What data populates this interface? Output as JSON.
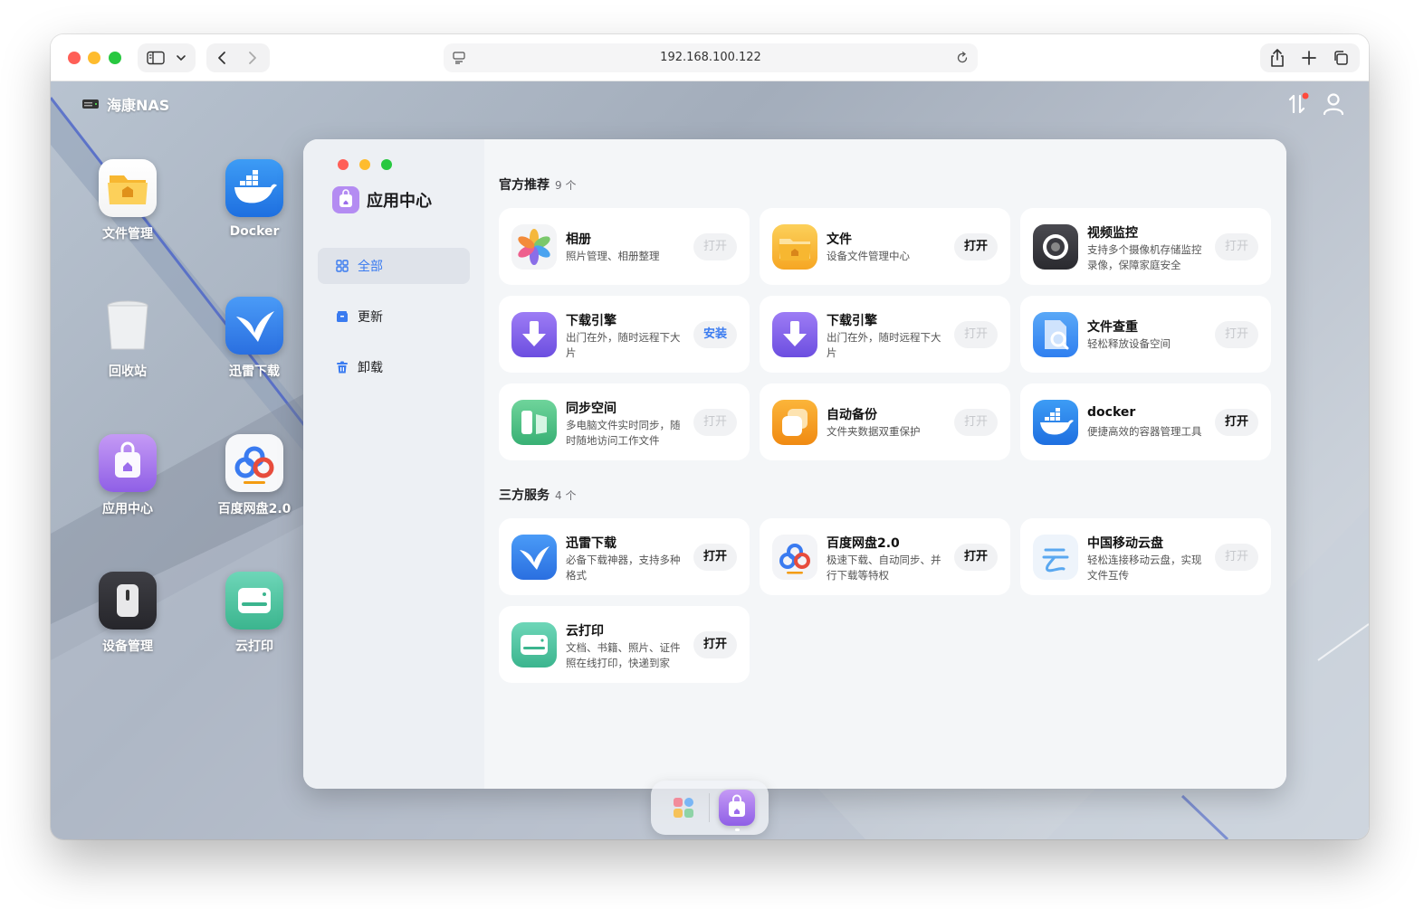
{
  "browser": {
    "url": "192.168.100.122"
  },
  "desktop": {
    "brand": "海康NAS",
    "icons": [
      {
        "label": "文件管理"
      },
      {
        "label": "Docker"
      },
      {
        "label": "回收站"
      },
      {
        "label": "迅雷下载"
      },
      {
        "label": "应用中心"
      },
      {
        "label": "百度网盘2.0"
      },
      {
        "label": "设备管理"
      },
      {
        "label": "云打印"
      }
    ]
  },
  "app": {
    "title": "应用中心",
    "nav": [
      {
        "label": "全部"
      },
      {
        "label": "更新"
      },
      {
        "label": "卸载"
      }
    ],
    "sections": [
      {
        "title": "官方推荐",
        "count": "9 个",
        "items": [
          {
            "name": "相册",
            "desc": "照片管理、相册整理",
            "action": "打开"
          },
          {
            "name": "文件",
            "desc": "设备文件管理中心",
            "action": "打开"
          },
          {
            "name": "视频监控",
            "desc": "支持多个摄像机存储监控录像，保障家庭安全",
            "action": "打开"
          },
          {
            "name": "下载引擎",
            "desc": "出门在外，随时远程下大片",
            "action": "安装"
          },
          {
            "name": "下载引擎",
            "desc": "出门在外，随时远程下大片",
            "action": "打开"
          },
          {
            "name": "文件查重",
            "desc": "轻松释放设备空间",
            "action": "打开"
          },
          {
            "name": "同步空间",
            "desc": "多电脑文件实时同步，随时随地访问工作文件",
            "action": "打开"
          },
          {
            "name": "自动备份",
            "desc": "文件夹数据双重保护",
            "action": "打开"
          },
          {
            "name": "docker",
            "desc": "便捷高效的容器管理工具",
            "action": "打开"
          }
        ]
      },
      {
        "title": "三方服务",
        "count": "4 个",
        "items": [
          {
            "name": "迅雷下载",
            "desc": "必备下载神器，支持多种格式",
            "action": "打开"
          },
          {
            "name": "百度网盘2.0",
            "desc": "极速下载、自动同步、并行下载等特权",
            "action": "打开"
          },
          {
            "name": "中国移动云盘",
            "desc": "轻松连接移动云盘，实现文件互传",
            "action": "打开"
          },
          {
            "name": "云打印",
            "desc": "文档、书籍、照片、证件照在线打印，快递到家",
            "action": "打开"
          }
        ]
      }
    ]
  },
  "colors": {
    "accent": "#3a7bf0",
    "traffic_red": "#ff5f57",
    "traffic_yellow": "#febc2e",
    "traffic_green": "#28c840"
  }
}
